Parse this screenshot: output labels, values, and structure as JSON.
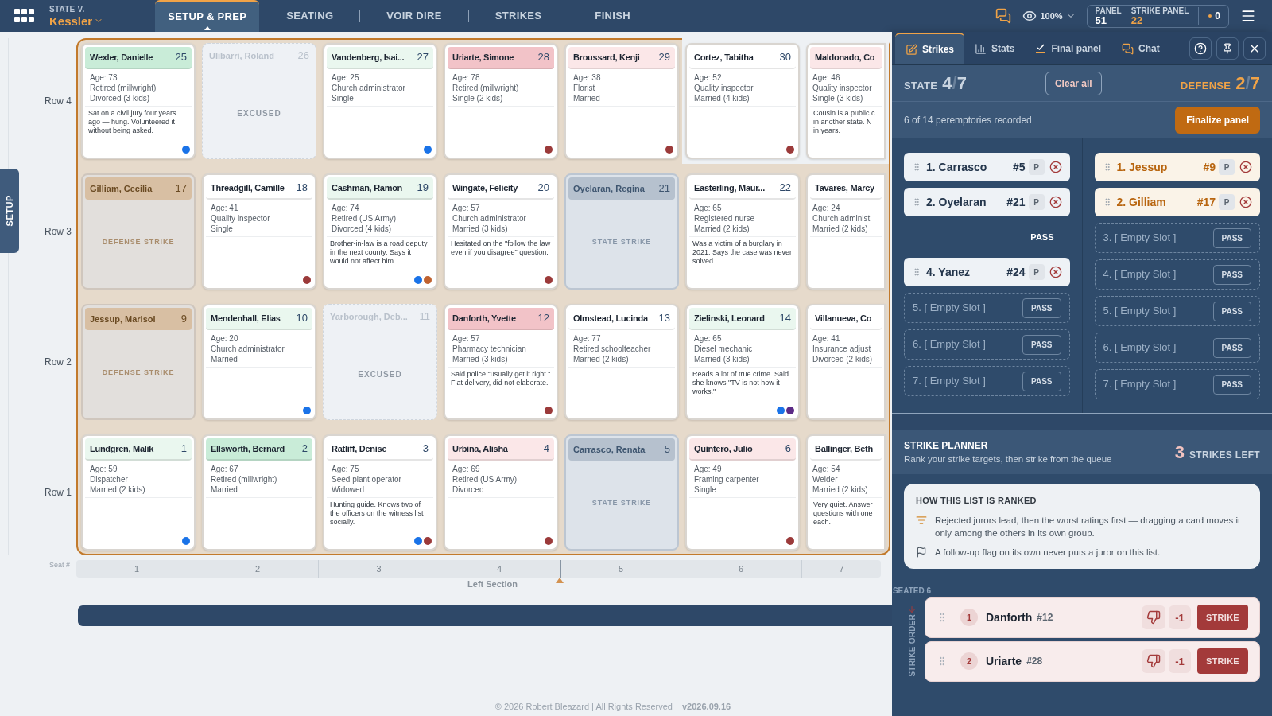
{
  "topbar": {
    "case_label": "STATE V.",
    "case_name": "Kessler",
    "tabs": [
      {
        "label": "SETUP & PREP",
        "selected": true
      },
      {
        "label": "SEATING",
        "selected": false
      },
      {
        "label": "VOIR DIRE",
        "selected": false
      },
      {
        "label": "STRIKES",
        "selected": false
      },
      {
        "label": "FINISH",
        "selected": false
      }
    ],
    "zoom": "100%",
    "panel_label": "PANEL",
    "panel_value": "51",
    "strike_panel_label": "STRIKE PANEL",
    "strike_panel_value": "22",
    "alerts": "0"
  },
  "side_tab": "SETUP",
  "rows": [
    {
      "label": "Row 4",
      "cards": [
        {
          "kind": "juror",
          "name": "Wexler, Danielle",
          "seat": "25",
          "color": "#c9ecd8",
          "details": [
            "Age: 73",
            "Retired (millwright)",
            "Divorced (3 kids)"
          ],
          "note": "Sat on a civil jury four years ago — hung. Volunteered it without being asked.",
          "dots": [
            {
              "color": "#1a73e8"
            }
          ]
        },
        {
          "kind": "excused",
          "name": "Ulibarri, Roland",
          "seat": "26",
          "status": "EXCUSED"
        },
        {
          "kind": "juror",
          "name": "Vandenberg, Isai...",
          "seat": "27",
          "color": "#eaf7ef",
          "details": [
            "Age: 25",
            "Church administrator",
            "Single"
          ],
          "dots": [
            {
              "color": "#1a73e8"
            }
          ]
        },
        {
          "kind": "juror",
          "name": "Uriarte, Simone",
          "seat": "28",
          "color": "#f2c3c8",
          "details": [
            "Age: 78",
            "Retired (millwright)",
            "Single (2 kids)"
          ],
          "dots": [
            {
              "color": "#9b3a3a"
            }
          ]
        },
        {
          "kind": "juror",
          "name": "Broussard, Kenji",
          "seat": "29",
          "color": "#fbe7e8",
          "details": [
            "Age: 38",
            "Florist",
            "Married"
          ],
          "dots": [
            {
              "color": "#9b3a3a"
            }
          ]
        },
        {
          "kind": "juror",
          "name": "Cortez, Tabitha",
          "seat": "30",
          "color": "#ffffff",
          "in_section": false,
          "details": [
            "Age: 52",
            "Quality inspector",
            "Married (4 kids)"
          ],
          "dots": [
            {
              "color": "#9b3a3a"
            }
          ]
        },
        {
          "kind": "juror",
          "name": "Maldonado, Co",
          "color": "#fbe7e8",
          "cut": true,
          "in_section": false,
          "details": [
            "Age: 46",
            "Quality inspector",
            "Single (3 kids)"
          ],
          "note": "Cousin is a public c in another state. N in years."
        }
      ]
    },
    {
      "label": "Row 3",
      "cards": [
        {
          "kind": "defense_strike",
          "name": "Gilliam, Cecilia",
          "seat": "17",
          "status": "DEFENSE STRIKE"
        },
        {
          "kind": "juror",
          "name": "Threadgill, Camille",
          "seat": "18",
          "color": "#ffffff",
          "details": [
            "Age: 41",
            "Quality inspector",
            "Single"
          ],
          "dots": [
            {
              "color": "#9b3a3a"
            }
          ]
        },
        {
          "kind": "juror",
          "name": "Cashman, Ramon",
          "seat": "19",
          "color": "#eaf7ef",
          "details": [
            "Age: 74",
            "Retired (US Army)",
            "Divorced (4 kids)"
          ],
          "note": "Brother-in-law is a road deputy in the next county. Says it would not affect him.",
          "dots": [
            {
              "color": "#1a73e8"
            },
            {
              "color": "#c0622f"
            }
          ]
        },
        {
          "kind": "juror",
          "name": "Wingate, Felicity",
          "seat": "20",
          "color": "#ffffff",
          "details": [
            "Age: 57",
            "Church administrator",
            "Married (3 kids)"
          ],
          "note": "Hesitated on the \"follow the law even if you disagree\" question.",
          "dots": [
            {
              "color": "#9b3a3a"
            }
          ]
        },
        {
          "kind": "state_strike",
          "name": "Oyelaran, Regina",
          "seat": "21",
          "status": "STATE STRIKE"
        },
        {
          "kind": "juror",
          "name": "Easterling, Maur...",
          "seat": "22",
          "color": "#ffffff",
          "details": [
            "Age: 65",
            "Registered nurse",
            "Married (2 kids)"
          ],
          "note": "Was a victim of a burglary in 2021. Says the case was never solved."
        },
        {
          "kind": "juror",
          "name": "Tavares, Marcy",
          "color": "#ffffff",
          "cut": true,
          "details": [
            "Age: 24",
            "Church administ",
            "Married (2 kids)"
          ]
        }
      ]
    },
    {
      "label": "Row 2",
      "cards": [
        {
          "kind": "defense_strike",
          "name": "Jessup, Marisol",
          "seat": "9",
          "status": "DEFENSE STRIKE"
        },
        {
          "kind": "juror",
          "name": "Mendenhall, Elias",
          "seat": "10",
          "color": "#eaf7ef",
          "details": [
            "Age: 20",
            "Church administrator",
            "Married"
          ],
          "dots": [
            {
              "color": "#1a73e8"
            }
          ]
        },
        {
          "kind": "excused",
          "name": "Yarborough, Deb...",
          "seat": "11",
          "status": "EXCUSED"
        },
        {
          "kind": "juror",
          "name": "Danforth, Yvette",
          "seat": "12",
          "color": "#f2c3c8",
          "details": [
            "Age: 57",
            "Pharmacy technician",
            "Married (3 kids)"
          ],
          "note": "Said police \"usually get it right.\" Flat delivery, did not elaborate.",
          "dots": [
            {
              "color": "#9b3a3a"
            }
          ]
        },
        {
          "kind": "juror",
          "name": "Olmstead, Lucinda",
          "seat": "13",
          "color": "#ffffff",
          "details": [
            "Age: 77",
            "Retired schoolteacher",
            "Married (2 kids)"
          ]
        },
        {
          "kind": "juror",
          "name": "Zielinski, Leonard",
          "seat": "14",
          "color": "#eaf7ef",
          "details": [
            "Age: 65",
            "Diesel mechanic",
            "Married (3 kids)"
          ],
          "note": "Reads a lot of true crime. Said she knows \"TV is not how it works.\"",
          "dots": [
            {
              "color": "#1a73e8"
            },
            {
              "color": "#5b2a86"
            }
          ]
        },
        {
          "kind": "juror",
          "name": "Villanueva, Co",
          "color": "#ffffff",
          "cut": true,
          "details": [
            "Age: 41",
            "Insurance adjust",
            "Divorced (2 kids)"
          ]
        }
      ]
    },
    {
      "label": "Row 1",
      "cards": [
        {
          "kind": "juror",
          "name": "Lundgren, Malik",
          "seat": "1",
          "color": "#eaf7ef",
          "details": [
            "Age: 59",
            "Dispatcher",
            "Married (2 kids)"
          ],
          "dots": [
            {
              "color": "#1a73e8"
            }
          ]
        },
        {
          "kind": "juror",
          "name": "Ellsworth, Bernard",
          "seat": "2",
          "color": "#c9ecd8",
          "details": [
            "Age: 67",
            "Retired (millwright)",
            "Married"
          ]
        },
        {
          "kind": "juror",
          "name": "Ratliff, Denise",
          "seat": "3",
          "color": "#ffffff",
          "details": [
            "Age: 75",
            "Seed plant operator",
            "Widowed"
          ],
          "note": "Hunting guide. Knows two of the officers on the witness list socially.",
          "dots": [
            {
              "color": "#1a73e8"
            },
            {
              "color": "#9b3a3a"
            }
          ]
        },
        {
          "kind": "juror",
          "name": "Urbina, Alisha",
          "seat": "4",
          "color": "#fbe7e8",
          "details": [
            "Age: 69",
            "Retired (US Army)",
            "Divorced"
          ],
          "dots": [
            {
              "color": "#9b3a3a"
            }
          ]
        },
        {
          "kind": "state_strike",
          "name": "Carrasco, Renata",
          "seat": "5",
          "status": "STATE STRIKE"
        },
        {
          "kind": "juror",
          "name": "Quintero, Julio",
          "seat": "6",
          "color": "#fbe7e8",
          "details": [
            "Age: 49",
            "Framing carpenter",
            "Single"
          ],
          "dots": [
            {
              "color": "#9b3a3a"
            }
          ]
        },
        {
          "kind": "juror",
          "name": "Ballinger, Beth",
          "color": "#ffffff",
          "cut": true,
          "details": [
            "Age: 54",
            "Welder",
            "Married (2 kids)"
          ],
          "note": "Very quiet. Answer questions with one each."
        }
      ]
    }
  ],
  "seat_axis": {
    "label": "Seat #",
    "seats": [
      "1",
      "2",
      "3",
      "4",
      "5",
      "6",
      "7"
    ],
    "section_label": "Left Section"
  },
  "footer": {
    "copyright": "© 2026 Robert Bleazard | All Rights Reserved",
    "version": "v2026.09.16"
  },
  "panel": {
    "tabs": [
      {
        "kind": "strikes",
        "label": "Strikes",
        "selected": true
      },
      {
        "kind": "stats",
        "label": "Stats",
        "selected": false
      },
      {
        "kind": "final",
        "label": "Final panel",
        "selected": false
      },
      {
        "kind": "chat",
        "label": "Chat",
        "selected": false
      }
    ],
    "state_label": "STATE",
    "state_score": {
      "count": "4",
      "sep": "/",
      "total": "7"
    },
    "clear_label": "Clear all",
    "defense_label": "DEFENSE",
    "defense_score": {
      "count": "2",
      "sep": "/",
      "total": "7"
    },
    "recorded": "6 of 14 peremptories recorded",
    "finalize": "Finalize panel",
    "state_slots": [
      {
        "kind": "filled",
        "label": "1. Carrasco",
        "seat": "#5",
        "flag": "P"
      },
      {
        "kind": "filled",
        "label": "2. Oyelaran",
        "seat": "#21",
        "flag": "P"
      },
      {
        "kind": "pass",
        "label": "PASS"
      },
      {
        "kind": "filled",
        "label": "4. Yanez",
        "seat": "#24",
        "flag": "P"
      },
      {
        "kind": "empty",
        "label": "5. [ Empty Slot ]",
        "action": "PASS"
      },
      {
        "kind": "empty",
        "label": "6. [ Empty Slot ]",
        "action": "PASS"
      },
      {
        "kind": "empty",
        "label": "7. [ Empty Slot ]",
        "action": "PASS"
      }
    ],
    "defense_slots": [
      {
        "kind": "filled",
        "label": "1. Jessup",
        "seat": "#9",
        "flag": "P"
      },
      {
        "kind": "filled",
        "label": "2. Gilliam",
        "seat": "#17",
        "flag": "P"
      },
      {
        "kind": "empty",
        "label": "3. [ Empty Slot ]",
        "action": "PASS"
      },
      {
        "kind": "empty",
        "label": "4. [ Empty Slot ]",
        "action": "PASS"
      },
      {
        "kind": "empty",
        "label": "5. [ Empty Slot ]",
        "action": "PASS"
      },
      {
        "kind": "empty",
        "label": "6. [ Empty Slot ]",
        "action": "PASS"
      },
      {
        "kind": "empty",
        "label": "7. [ Empty Slot ]",
        "action": "PASS"
      }
    ],
    "planner": {
      "title": "STRIKE PLANNER",
      "subtitle": "Rank your strike targets, then strike from the queue",
      "count": "3",
      "count_label": "STRIKES LEFT",
      "info_title": "HOW THIS LIST IS RANKED",
      "info_lines": [
        {
          "kind": "sort",
          "text": "Rejected jurors lead, then the worst ratings first — dragging a card moves it only among the others in its own group."
        },
        {
          "kind": "flag",
          "text": "A follow-up flag on its own never puts a juror on this list."
        }
      ],
      "seated_label": "SEATED",
      "seated_count": "6",
      "order_label": "STRIKE ORDER",
      "queue": [
        {
          "rank": "1",
          "name": "Danforth",
          "seat": "#12",
          "rating": "-1",
          "action": "STRIKE"
        },
        {
          "rank": "2",
          "name": "Uriarte",
          "seat": "#28",
          "rating": "-1",
          "action": "STRIKE"
        }
      ]
    }
  }
}
